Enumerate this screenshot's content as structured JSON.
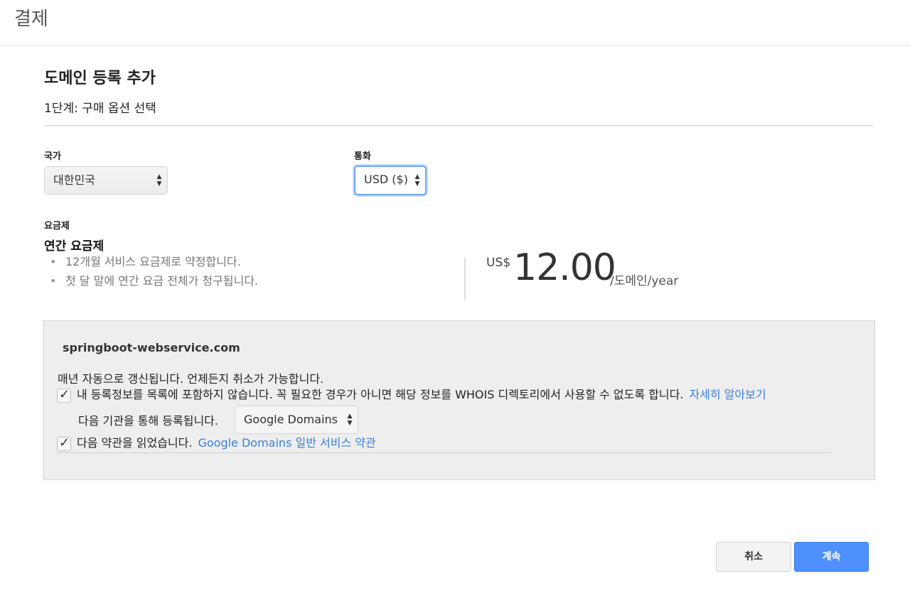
{
  "header": {
    "title": "결제"
  },
  "page": {
    "title": "도메인 등록 추가",
    "step": "1단계: 구매 옵션 선택"
  },
  "country": {
    "label": "국가",
    "value": "대한민국"
  },
  "currency": {
    "label": "통화",
    "value": "USD ($)"
  },
  "plan": {
    "label": "요금제",
    "name": "연간 요금제",
    "bullets": [
      "12개월 서비스 요금제로 약정합니다.",
      "첫 달 말에 연간 요금 전체가 청구됩니다."
    ]
  },
  "price": {
    "currency": "US$",
    "amount": "12.00",
    "unit": "/도메인/year"
  },
  "domain": {
    "name": "springboot-webservice.com",
    "renew_text": "매년 자동으로 갱신됩니다. 언제든지 취소가 가능합니다.",
    "privacy_text": "내 등록정보를 목록에 포함하지 않습니다. 꼭 필요한 경우가 아니면 해당 정보를 WHOIS 디렉토리에서 사용할 수 없도록 합니다.",
    "privacy_link": "자세히 알아보기",
    "privacy_checked": true,
    "registrar_label": "다음 기관을 통해 등록됩니다.",
    "registrar_value": "Google Domains",
    "terms_text": "다음 약관을 읽었습니다.",
    "terms_link": "Google Domains 일반 서비스 약관",
    "terms_checked": true
  },
  "buttons": {
    "cancel": "취소",
    "continue": "계속"
  },
  "colors": {
    "link": "#3a7fdc",
    "primary": "#4d90fe",
    "focus": "#6ea6f5"
  }
}
